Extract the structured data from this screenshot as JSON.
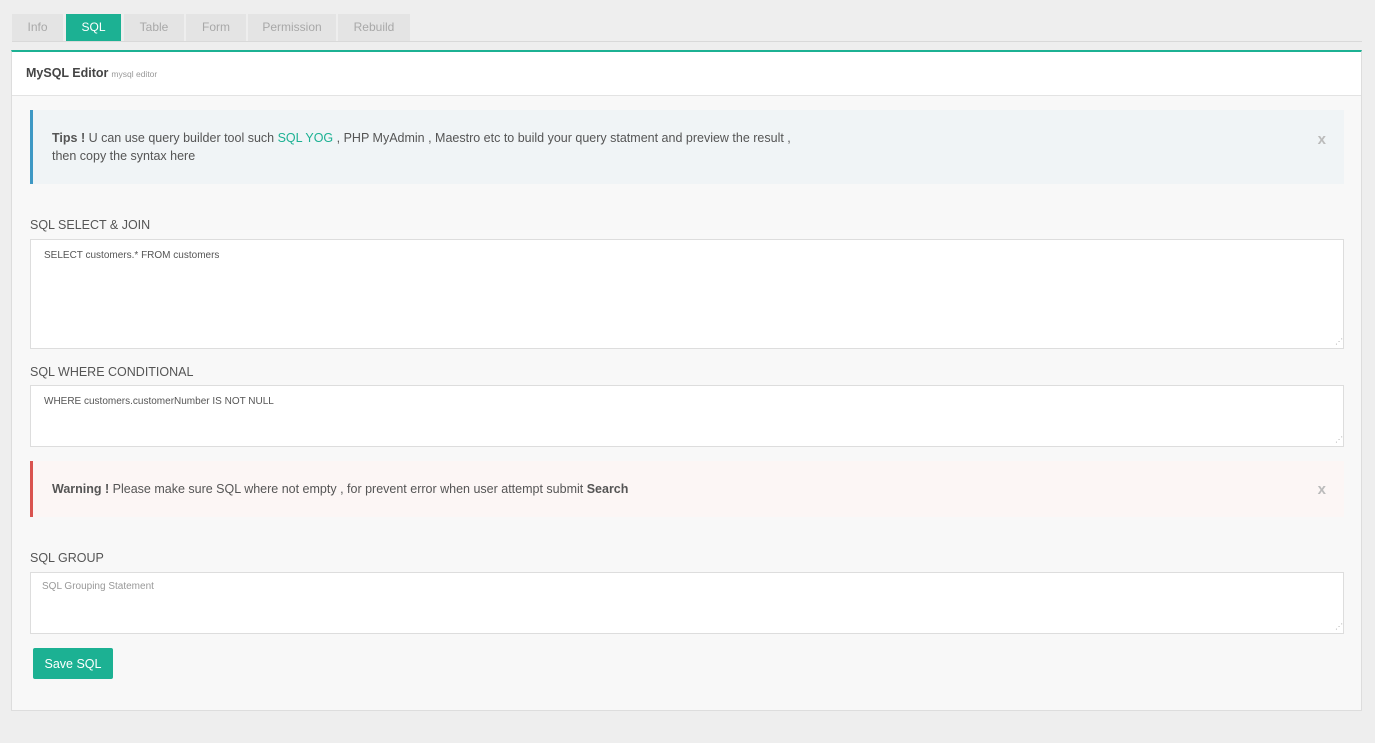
{
  "tabs": [
    {
      "label": "Info"
    },
    {
      "label": "SQL"
    },
    {
      "label": "Table"
    },
    {
      "label": "Form"
    },
    {
      "label": "Permission"
    },
    {
      "label": "Rebuild"
    }
  ],
  "active_tab": "SQL",
  "panel": {
    "title": "MySQL Editor",
    "subtitle": "mysql editor"
  },
  "tips": {
    "strong": "Tips !",
    "text_before": " U can use query builder tool such ",
    "link": "SQL YOG",
    "text_after": " , PHP MyAdmin , Maestro etc to build your query statment and preview the result ,",
    "line2": "then copy the syntax here",
    "close": "x"
  },
  "select_join": {
    "label": "SQL SELECT & JOIN",
    "value": "SELECT customers.* FROM customers"
  },
  "where": {
    "label": "SQL WHERE CONDITIONAL",
    "value": "WHERE customers.customerNumber IS NOT NULL"
  },
  "warning": {
    "strong": "Warning !",
    "text": " Please make sure SQL where not empty , for prevent error when user attempt submit ",
    "emphasis": "Search",
    "close": "x"
  },
  "group": {
    "label": "SQL GROUP",
    "value": "",
    "placeholder": "SQL Grouping Statement"
  },
  "save_button": "Save SQL",
  "colors": {
    "accent": "#1cb193",
    "info_border": "#3e98c4",
    "warning_border": "#d9534f"
  }
}
